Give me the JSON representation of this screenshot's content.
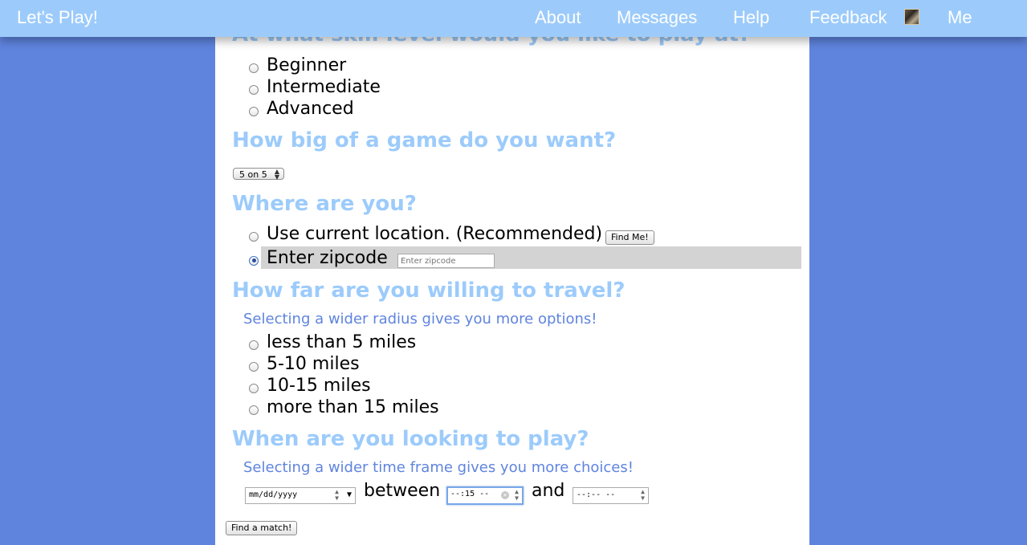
{
  "nav": {
    "brand": "Let's Play!",
    "links": [
      "About",
      "Messages",
      "Help",
      "Feedback",
      "Me"
    ]
  },
  "skill": {
    "title": "At what skill level would you like to play at?",
    "options": [
      "Beginner",
      "Intermediate",
      "Advanced"
    ]
  },
  "game_size": {
    "title": "How big of a game do you want?",
    "selected": "5 on 5"
  },
  "location": {
    "title": "Where are you?",
    "current_label": "Use current location. (Recommended)",
    "find_me_button": "Find Me!",
    "zip_label": "Enter zipcode",
    "zip_placeholder": "Enter zipcode",
    "selected": "zipcode"
  },
  "travel": {
    "title": "How far are you willing to travel?",
    "hint": "Selecting a wider radius gives you more options!",
    "options": [
      "less than 5 miles",
      "5-10 miles",
      "10-15 miles",
      "more than 15 miles"
    ]
  },
  "when": {
    "title": "When are you looking to play?",
    "hint": "Selecting a wider time frame gives you more choices!",
    "date_value": "mm/dd/yyyy",
    "between_label": "between",
    "start_time_value": "--:15 --",
    "and_label": "and",
    "end_time_value": "--:-- --"
  },
  "submit_label": "Find a match!"
}
